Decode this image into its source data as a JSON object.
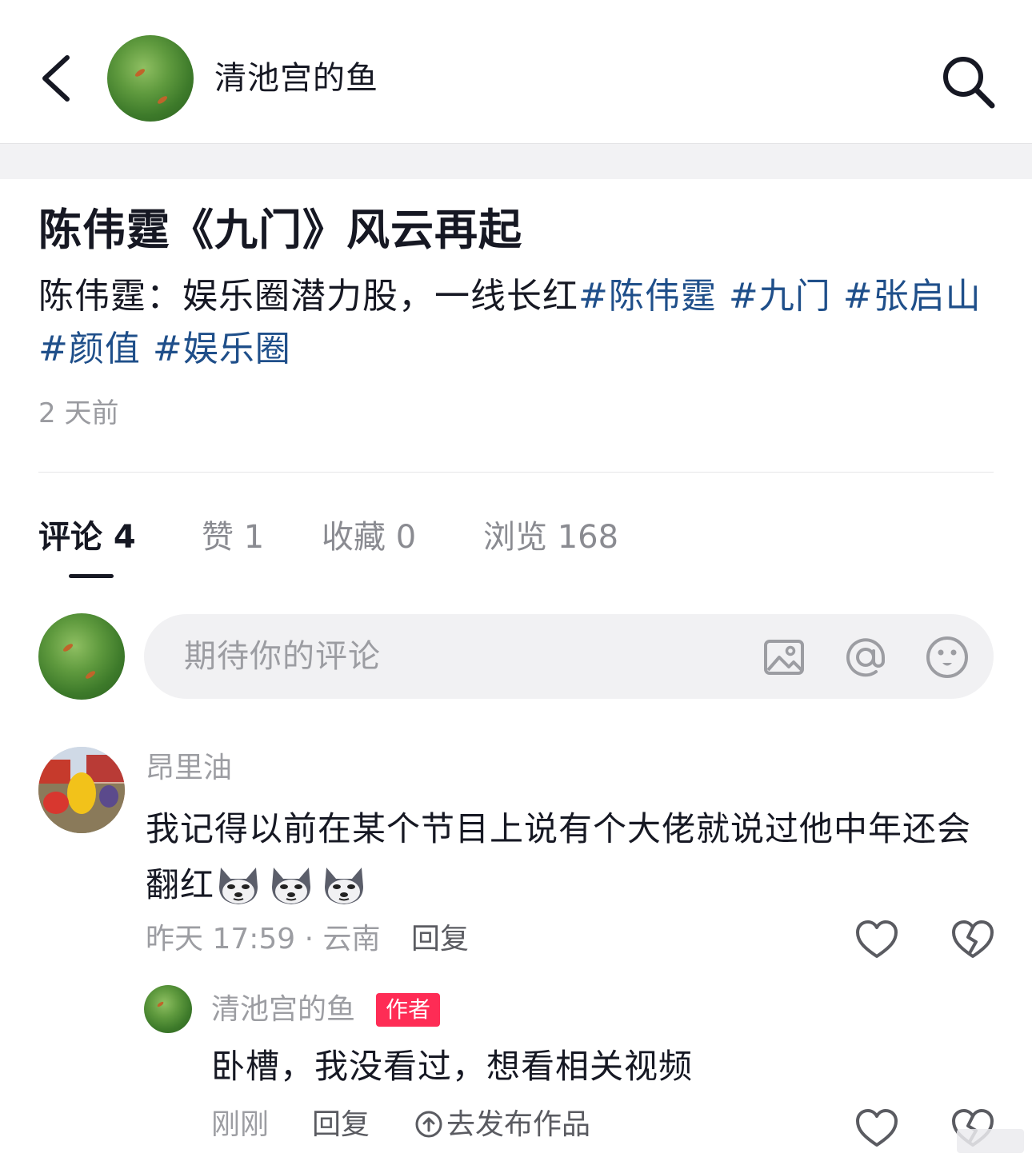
{
  "header": {
    "username": "清池宫的鱼"
  },
  "post": {
    "title": "陈伟霆《九门》风云再起",
    "body_text": "陈伟霆：娱乐圈潜力股，一线长红",
    "hashtags": [
      "#陈伟霆",
      "#九门",
      "#张启山",
      "#颜值",
      "#娱乐圈"
    ],
    "time": "2 天前"
  },
  "tabs": [
    {
      "label": "评论 4",
      "active": true
    },
    {
      "label": "赞 1",
      "active": false
    },
    {
      "label": "收藏 0",
      "active": false
    },
    {
      "label": "浏览 168",
      "active": false
    }
  ],
  "comment_input": {
    "placeholder": "期待你的评论",
    "icons": [
      "image-icon",
      "at-icon",
      "emoji-icon"
    ]
  },
  "comments": [
    {
      "username": "昂里油",
      "text_line1": "我记得以前在某个节目上说有个大佬就说过他中年还会",
      "text_line2": "翻红",
      "emoji_count": 3,
      "time_location": "昨天 17:59 · 云南",
      "reply_label": "回复",
      "replies": [
        {
          "username": "清池宫的鱼",
          "badge": "作者",
          "text": "卧槽，我没看过，想看相关视频",
          "time": "刚刚",
          "reply_label": "回复",
          "publish_label": "去发布作品"
        }
      ]
    }
  ],
  "colors": {
    "text_primary": "#161823",
    "text_secondary": "#9c9da2",
    "hashtag": "#1f4f8a",
    "author_badge": "#fe2c55",
    "input_bg": "#f1f1f3"
  }
}
